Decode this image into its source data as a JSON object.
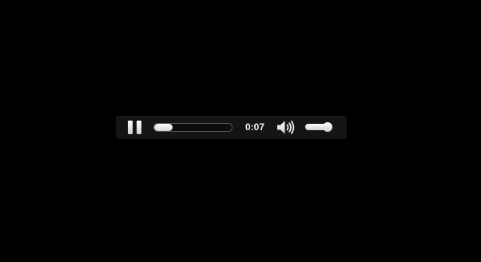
{
  "player": {
    "playback_state": "playing",
    "pause_icon": "pause-icon",
    "time_elapsed": "0:07",
    "progress_fraction": 0.03,
    "volume_icon": "speaker-volume-icon",
    "volume_fraction": 1.0
  },
  "colors": {
    "background": "#000000",
    "bar": "#141414",
    "control": "#ffffff",
    "track_border": "#5a5a5a"
  }
}
